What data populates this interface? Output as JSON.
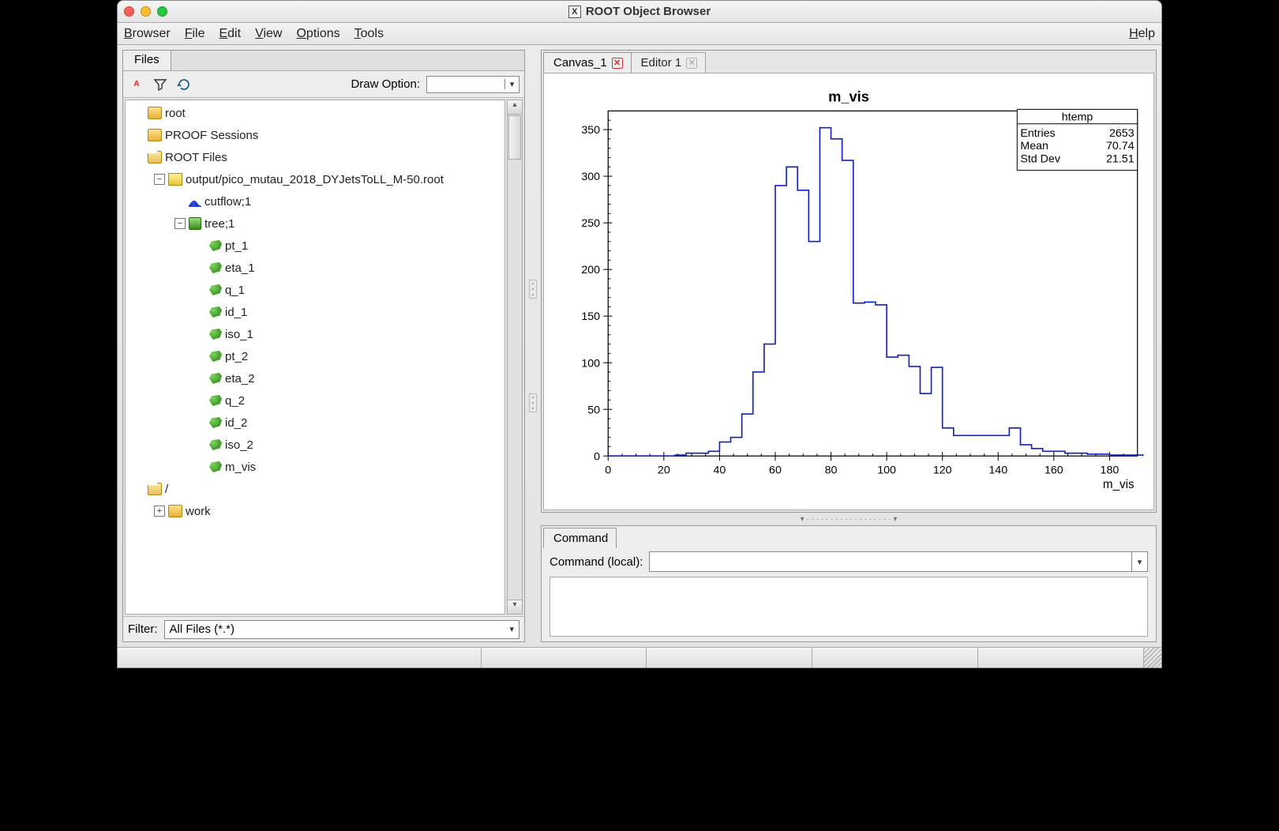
{
  "window": {
    "title": "ROOT Object Browser"
  },
  "menubar": {
    "items": [
      "Browser",
      "File",
      "Edit",
      "View",
      "Options",
      "Tools"
    ],
    "right": "Help"
  },
  "left": {
    "tab": "Files",
    "draw_option_label": "Draw Option:",
    "draw_option_value": "",
    "filter_label": "Filter:",
    "filter_value": "All Files (*.*)",
    "tree": {
      "items": [
        {
          "depth": 0,
          "icon": "folder",
          "label": "root",
          "exp": null
        },
        {
          "depth": 0,
          "icon": "folder",
          "label": "PROOF Sessions",
          "exp": null
        },
        {
          "depth": 0,
          "icon": "folder-open",
          "label": "ROOT Files",
          "exp": null
        },
        {
          "depth": 1,
          "icon": "rootfile",
          "label": "output/pico_mutau_2018_DYJetsToLL_M-50.root",
          "exp": "-"
        },
        {
          "depth": 2,
          "icon": "hist",
          "label": "cutflow;1",
          "exp": null
        },
        {
          "depth": 2,
          "icon": "tree",
          "label": "tree;1",
          "exp": "-"
        },
        {
          "depth": 3,
          "icon": "leaf",
          "label": "pt_1",
          "exp": null
        },
        {
          "depth": 3,
          "icon": "leaf",
          "label": "eta_1",
          "exp": null
        },
        {
          "depth": 3,
          "icon": "leaf",
          "label": "q_1",
          "exp": null
        },
        {
          "depth": 3,
          "icon": "leaf",
          "label": "id_1",
          "exp": null
        },
        {
          "depth": 3,
          "icon": "leaf",
          "label": "iso_1",
          "exp": null
        },
        {
          "depth": 3,
          "icon": "leaf",
          "label": "pt_2",
          "exp": null
        },
        {
          "depth": 3,
          "icon": "leaf",
          "label": "eta_2",
          "exp": null
        },
        {
          "depth": 3,
          "icon": "leaf",
          "label": "q_2",
          "exp": null
        },
        {
          "depth": 3,
          "icon": "leaf",
          "label": "id_2",
          "exp": null
        },
        {
          "depth": 3,
          "icon": "leaf",
          "label": "iso_2",
          "exp": null
        },
        {
          "depth": 3,
          "icon": "leaf",
          "label": "m_vis",
          "exp": null
        },
        {
          "depth": 0,
          "icon": "folder-open",
          "label": "/",
          "exp": null
        },
        {
          "depth": 1,
          "icon": "folder",
          "label": "work",
          "exp": "+"
        }
      ]
    }
  },
  "canvas": {
    "tabs": [
      {
        "label": "Canvas_1",
        "closable": true,
        "active": true
      },
      {
        "label": "Editor 1",
        "closable": true,
        "active": false,
        "disabled": true
      }
    ]
  },
  "cmd": {
    "tab": "Command",
    "label": "Command (local):",
    "value": ""
  },
  "stats": {
    "name": "htemp",
    "rows": [
      [
        "Entries",
        "2653"
      ],
      [
        "Mean",
        "70.74"
      ],
      [
        "Std Dev",
        "21.51"
      ]
    ]
  },
  "chart_data": {
    "type": "hist-step",
    "title": "m_vis",
    "xlabel": "m_vis",
    "ylabel": "",
    "xlim": [
      0,
      190
    ],
    "ylim": [
      0,
      370
    ],
    "xticks": [
      0,
      20,
      40,
      60,
      80,
      100,
      120,
      140,
      160,
      180
    ],
    "yticks": [
      0,
      50,
      100,
      150,
      200,
      250,
      300,
      350
    ],
    "bin_width": 4,
    "bin_edges_start": 0,
    "values": [
      0,
      0,
      0,
      0,
      0,
      0,
      1,
      3,
      3,
      5,
      15,
      20,
      45,
      90,
      120,
      290,
      310,
      285,
      230,
      352,
      340,
      317,
      164,
      165,
      162,
      106,
      108,
      96,
      67,
      95,
      30,
      22,
      22,
      22,
      22,
      22,
      30,
      12,
      8,
      5,
      5,
      3,
      3,
      2,
      2,
      1,
      1,
      1
    ]
  }
}
